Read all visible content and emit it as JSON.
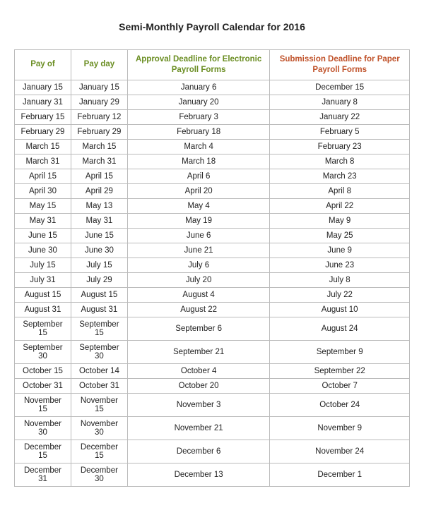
{
  "title": "Semi-Monthly Payroll Calendar for 2016",
  "headers": {
    "pay_of": "Pay of",
    "pay_day": "Pay day",
    "approval": "Approval Deadline for Electronic Payroll Forms",
    "submission": "Submission Deadline for Paper Payroll Forms"
  },
  "rows": [
    {
      "pay_of": "January 15",
      "pay_day": "January 15",
      "approval": "January 6",
      "submission": "December 15"
    },
    {
      "pay_of": "January 31",
      "pay_day": "January 29",
      "approval": "January 20",
      "submission": "January 8"
    },
    {
      "pay_of": "February 15",
      "pay_day": "February 12",
      "approval": "February 3",
      "submission": "January 22"
    },
    {
      "pay_of": "February 29",
      "pay_day": "February 29",
      "approval": "February 18",
      "submission": "February 5"
    },
    {
      "pay_of": "March 15",
      "pay_day": "March 15",
      "approval": "March 4",
      "submission": "February 23"
    },
    {
      "pay_of": "March 31",
      "pay_day": "March 31",
      "approval": "March 18",
      "submission": "March 8"
    },
    {
      "pay_of": "April 15",
      "pay_day": "April 15",
      "approval": "April 6",
      "submission": "March 23"
    },
    {
      "pay_of": "April 30",
      "pay_day": "April 29",
      "approval": "April 20",
      "submission": "April 8"
    },
    {
      "pay_of": "May 15",
      "pay_day": "May 13",
      "approval": "May 4",
      "submission": "April 22"
    },
    {
      "pay_of": "May 31",
      "pay_day": "May 31",
      "approval": "May 19",
      "submission": "May 9"
    },
    {
      "pay_of": "June 15",
      "pay_day": "June 15",
      "approval": "June 6",
      "submission": "May 25"
    },
    {
      "pay_of": "June 30",
      "pay_day": "June 30",
      "approval": "June 21",
      "submission": "June 9"
    },
    {
      "pay_of": "July 15",
      "pay_day": "July 15",
      "approval": "July 6",
      "submission": "June 23"
    },
    {
      "pay_of": "July 31",
      "pay_day": "July 29",
      "approval": "July 20",
      "submission": "July 8"
    },
    {
      "pay_of": "August 15",
      "pay_day": "August 15",
      "approval": "August 4",
      "submission": "July 22"
    },
    {
      "pay_of": "August 31",
      "pay_day": "August 31",
      "approval": "August 22",
      "submission": "August 10"
    },
    {
      "pay_of": "September 15",
      "pay_day": "September 15",
      "approval": "September 6",
      "submission": "August 24"
    },
    {
      "pay_of": "September 30",
      "pay_day": "September 30",
      "approval": "September 21",
      "submission": "September 9"
    },
    {
      "pay_of": "October 15",
      "pay_day": "October 14",
      "approval": "October 4",
      "submission": "September 22"
    },
    {
      "pay_of": "October 31",
      "pay_day": "October 31",
      "approval": "October 20",
      "submission": "October 7"
    },
    {
      "pay_of": "November 15",
      "pay_day": "November 15",
      "approval": "November 3",
      "submission": "October 24"
    },
    {
      "pay_of": "November 30",
      "pay_day": "November 30",
      "approval": "November 21",
      "submission": "November 9"
    },
    {
      "pay_of": "December 15",
      "pay_day": "December 15",
      "approval": "December 6",
      "submission": "November 24"
    },
    {
      "pay_of": "December 31",
      "pay_day": "December 30",
      "approval": "December 13",
      "submission": "December 1"
    }
  ]
}
